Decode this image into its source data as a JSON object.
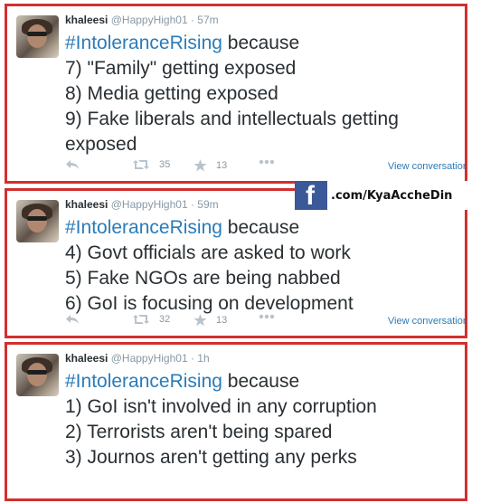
{
  "tweets": [
    {
      "display_name": "khaleesi",
      "handle": "@HappyHigh01",
      "time": "· 57m",
      "hashtag": "#IntoleranceRising",
      "after_hashtag": " because",
      "lines": [
        "7) \"Family\" getting exposed",
        "8) Media getting exposed",
        "9) Fake liberals and intellectuals getting exposed"
      ],
      "retweets": "35",
      "favorites": "13",
      "view_conversation": "View conversation"
    },
    {
      "display_name": "khaleesi",
      "handle": "@HappyHigh01",
      "time": "· 59m",
      "hashtag": "#IntoleranceRising",
      "after_hashtag": " because",
      "lines": [
        "4) Govt officials are asked to work",
        "5) Fake NGOs are being nabbed",
        "6) GoI is focusing on development"
      ],
      "retweets": "32",
      "favorites": "13",
      "view_conversation": "View conversation"
    },
    {
      "display_name": "khaleesi",
      "handle": "@HappyHigh01",
      "time": "· 1h",
      "hashtag": "#IntoleranceRising",
      "after_hashtag": " because",
      "lines": [
        "1) GoI isn't involved in any corruption",
        "2) Terrorists aren't being spared",
        "3) Journos aren't getting any perks"
      ]
    }
  ],
  "watermark": {
    "logo_letter": "f",
    "text": ".com/KyaAccheDin"
  },
  "colors": {
    "hashtag": "#2b7bb9",
    "border": "#d32f2f",
    "facebook": "#3b5998"
  }
}
